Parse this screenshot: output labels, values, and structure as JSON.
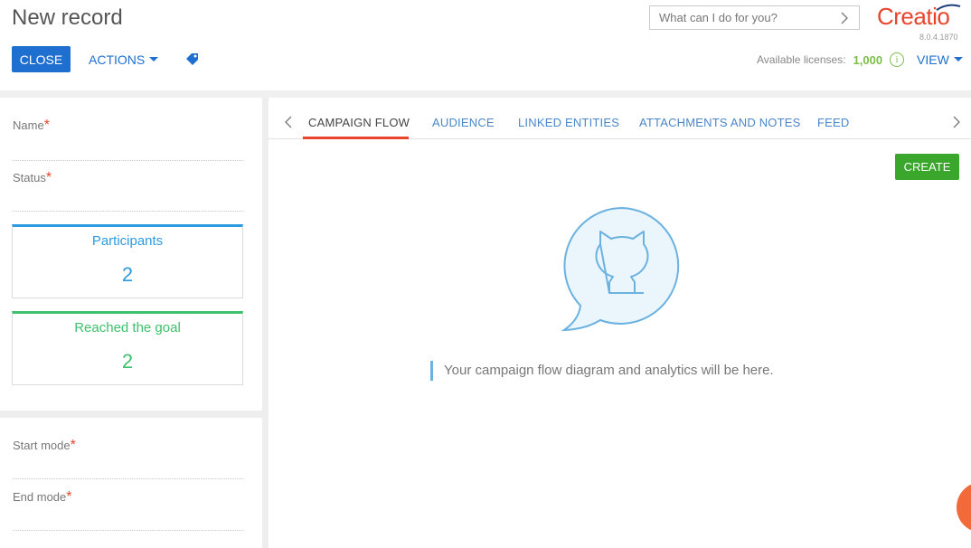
{
  "header": {
    "title": "New record",
    "close_label": "CLOSE",
    "actions_label": "ACTIONS",
    "search_placeholder": "What can I do for you?",
    "logo_text": "Creatio",
    "version": "8.0.4.1870",
    "licenses_label": "Available licenses:",
    "licenses_value": "1,000",
    "view_label": "VIEW"
  },
  "left": {
    "fields_top": [
      {
        "label": "Name",
        "required": "*"
      },
      {
        "label": "Status",
        "required": "*"
      }
    ],
    "metrics": [
      {
        "title": "Participants",
        "value": "2"
      },
      {
        "title": "Reached the goal",
        "value": "2"
      }
    ],
    "fields_bottom": [
      {
        "label": "Start mode",
        "required": "*"
      },
      {
        "label": "End mode",
        "required": "*"
      }
    ]
  },
  "tabs": [
    {
      "label": "CAMPAIGN FLOW"
    },
    {
      "label": "AUDIENCE"
    },
    {
      "label": "LINKED ENTITIES"
    },
    {
      "label": "ATTACHMENTS AND NOTES"
    },
    {
      "label": "FEED"
    }
  ],
  "main": {
    "create_label": "CREATE",
    "empty_message": "Your campaign flow diagram and analytics will be here."
  },
  "colors": {
    "primary": "#1f6fd1",
    "brand": "#e8442b",
    "success": "#3aa62c",
    "participants": "#2d9be1",
    "goal": "#3ec16c"
  },
  "icons": [
    "tag-icon",
    "chevron-right-icon",
    "info-icon",
    "chevron-left-icon",
    "github-cat-icon"
  ]
}
